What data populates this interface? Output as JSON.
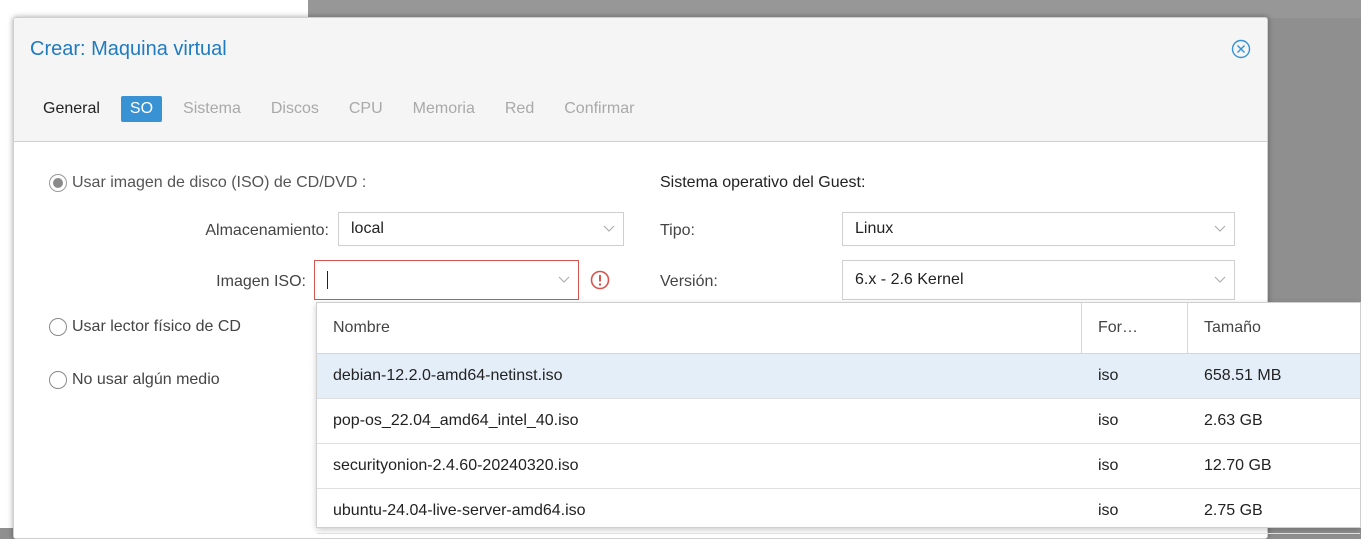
{
  "dialog": {
    "title": "Crear: Maquina virtual",
    "tabs": [
      {
        "label": "General",
        "state": "normal"
      },
      {
        "label": "SO",
        "state": "selected"
      },
      {
        "label": "Sistema",
        "state": "disabled"
      },
      {
        "label": "Discos",
        "state": "disabled"
      },
      {
        "label": "CPU",
        "state": "disabled"
      },
      {
        "label": "Memoria",
        "state": "disabled"
      },
      {
        "label": "Red",
        "state": "disabled"
      },
      {
        "label": "Confirmar",
        "state": "disabled"
      }
    ]
  },
  "media": {
    "option_iso": "Usar imagen de disco (ISO) de CD/DVD :",
    "option_physical": "Usar lector físico de CD",
    "option_none": "No usar algún medio",
    "storage_label": "Almacenamiento:",
    "storage_value": "local",
    "iso_label": "Imagen ISO:",
    "iso_value": ""
  },
  "guest": {
    "section_title": "Sistema operativo del Guest:",
    "type_label": "Tipo:",
    "type_value": "Linux",
    "version_label": "Versión:",
    "version_value": "6.x - 2.6 Kernel"
  },
  "iso_list": {
    "columns": [
      "Nombre",
      "For…",
      "Tamaño"
    ],
    "rows": [
      {
        "name": "debian-12.2.0-amd64-netinst.iso",
        "format": "iso",
        "size": "658.51 MB"
      },
      {
        "name": "pop-os_22.04_amd64_intel_40.iso",
        "format": "iso",
        "size": "2.63 GB"
      },
      {
        "name": "securityonion-2.4.60-20240320.iso",
        "format": "iso",
        "size": "12.70 GB"
      },
      {
        "name": "ubuntu-24.04-live-server-amd64.iso",
        "format": "iso",
        "size": "2.75 GB"
      }
    ]
  },
  "colors": {
    "accent": "#3892d3",
    "title": "#1f7bc1",
    "error": "#d9534f",
    "highlight_row": "#e4eef8"
  }
}
